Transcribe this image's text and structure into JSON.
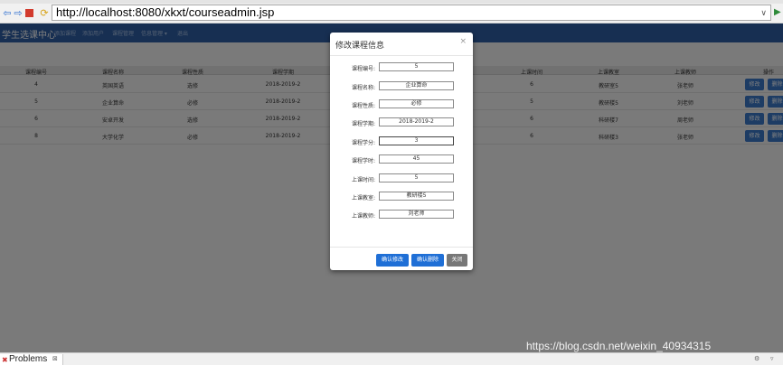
{
  "browser": {
    "url": "http://localhost:8080/xkxt/courseadmin.jsp",
    "back_icon": "back-arrow-icon",
    "forward_icon": "forward-arrow-icon",
    "stop_icon": "stop-icon",
    "refresh_icon": "refresh-icon",
    "dropdown_glyph": "∨",
    "go_glyph": "▶"
  },
  "nav": {
    "brand": "学生选课中心",
    "items": [
      "添加课程",
      "添加用户",
      "课程管理",
      "信息管理 ▾",
      "退出"
    ]
  },
  "table": {
    "headers": [
      "课程编号",
      "课程名称",
      "课程性质",
      "课程学期",
      "",
      "上课时间",
      "上课教室",
      "上课教师",
      "操作"
    ],
    "rows": [
      {
        "id": "4",
        "name": "英国英语",
        "type": "选修",
        "term": "2018-2019-2",
        "time": "6",
        "room": "教研室5",
        "teacher": "张老师"
      },
      {
        "id": "5",
        "name": "企业算命",
        "type": "必修",
        "term": "2018-2019-2",
        "time": "5",
        "room": "教研楼5",
        "teacher": "刘老师"
      },
      {
        "id": "6",
        "name": "安卓开发",
        "type": "选修",
        "term": "2018-2019-2",
        "time": "6",
        "room": "科研楼7",
        "teacher": "周老师"
      },
      {
        "id": "8",
        "name": "大学化学",
        "type": "必修",
        "term": "2018-2019-2",
        "time": "6",
        "room": "科研楼3",
        "teacher": "张老师"
      }
    ],
    "edit_label": "修改",
    "delete_label": "删除"
  },
  "modal": {
    "title": "修改课程信息",
    "close_glyph": "×",
    "fields": [
      {
        "label": "课程编号:",
        "value": "5"
      },
      {
        "label": "课程名称:",
        "value": "企业算命"
      },
      {
        "label": "课程性质:",
        "value": "必修"
      },
      {
        "label": "课程学期:",
        "value": "2018-2019-2"
      },
      {
        "label": "课程学分:",
        "value": "3"
      },
      {
        "label": "课程学时:",
        "value": "45"
      },
      {
        "label": "上课时间:",
        "value": "5"
      },
      {
        "label": "上课教室:",
        "value": "教研楼5"
      },
      {
        "label": "上课教师:",
        "value": "刘老师"
      }
    ],
    "confirm_edit_label": "确认修改",
    "confirm_delete_label": "确认删除",
    "close_label": "关闭"
  },
  "panel": {
    "tab_label": "Problems",
    "tab_close": "⊠"
  },
  "watermark": "https://blog.csdn.net/weixin_40934315",
  "colors": {
    "navbar": "#2f5fa5",
    "primary_button": "#1f6fd6",
    "table_button": "#3a78c9",
    "overlay": "rgba(0,0,0,0.5)"
  }
}
